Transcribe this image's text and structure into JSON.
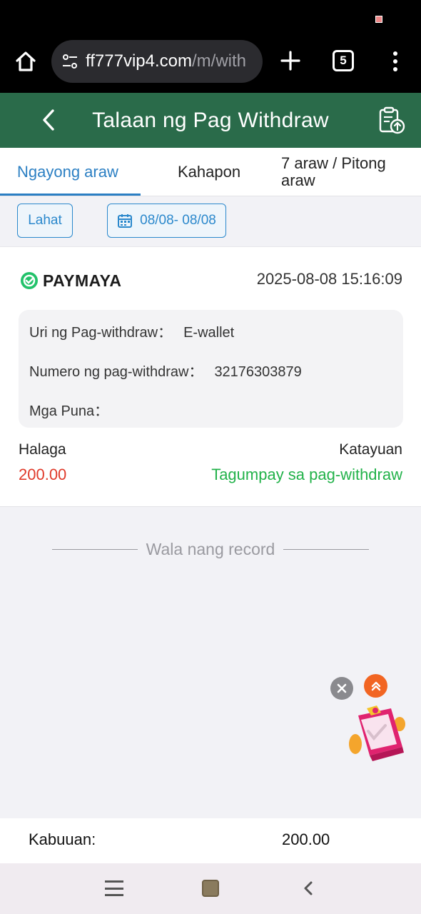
{
  "browser": {
    "url_domain": "ff777vip4.com",
    "url_path": "/m/with",
    "tab_count": "5",
    "icons": [
      "home-icon",
      "site-settings-icon",
      "plus-icon",
      "tabs-icon",
      "more-vert-icon"
    ]
  },
  "header": {
    "title": "Talaan ng Pag Withdraw",
    "icons": [
      "chevron-left-icon",
      "clipboard-upload-icon"
    ]
  },
  "tabs": [
    {
      "label": "Ngayong araw",
      "active": true
    },
    {
      "label": "Kahapon",
      "active": false
    },
    {
      "label": "7 araw / Pitong araw",
      "active": false
    }
  ],
  "filters": {
    "all_label": "Lahat",
    "date_range": "08/08- 08/08"
  },
  "record": {
    "provider": "PAYMAYA",
    "datetime": "2025-08-08 15:16:09",
    "type_label": "Uri ng Pag-withdraw：",
    "type_value": "E-wallet",
    "number_label": "Numero ng pag-withdraw：",
    "number_value": "32176303879",
    "remarks_label": "Mga Puna：",
    "remarks_value": "",
    "amount_label": "Halaga",
    "amount_value": "200.00",
    "status_label": "Katayuan",
    "status_value": "Tagumpay sa pag-withdraw"
  },
  "no_more": "Wala nang record",
  "total": {
    "label": "Kabuuan:",
    "value": "200.00"
  },
  "colors": {
    "header_green": "#2a6b4a",
    "accent_blue": "#2b7fc3",
    "amount_red": "#e03a2a",
    "status_green": "#22b24a",
    "fab_orange": "#f26522"
  }
}
